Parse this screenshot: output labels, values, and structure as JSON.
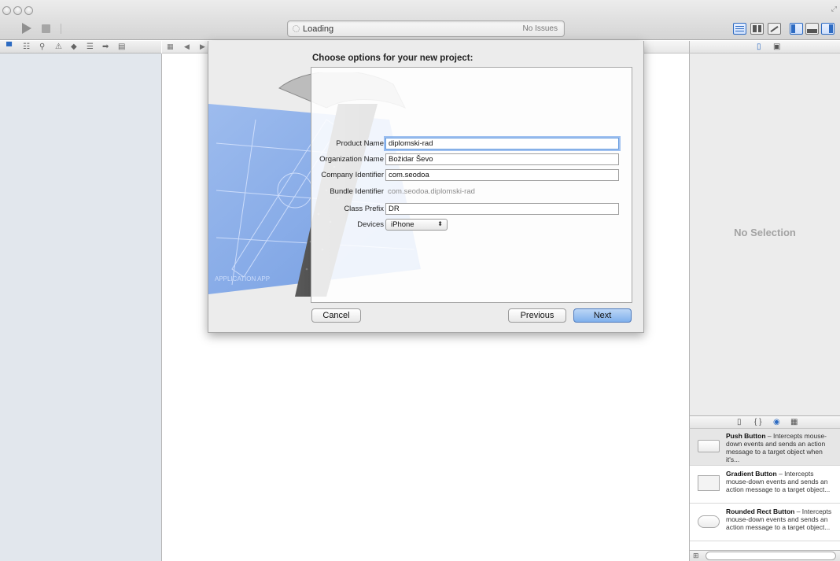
{
  "toolbar": {
    "activity_status": "Loading",
    "issues_status": "No Issues"
  },
  "inspector": {
    "empty_message": "No Selection"
  },
  "dialog": {
    "title": "Choose options for your new project:",
    "fields": {
      "product_name": {
        "label": "Product Name",
        "value": "diplomski-rad"
      },
      "organization_name": {
        "label": "Organization Name",
        "value": "Božidar Ševo"
      },
      "company_identifier": {
        "label": "Company Identifier",
        "value": "com.seodoa"
      },
      "bundle_identifier": {
        "label": "Bundle Identifier",
        "value": "com.seodoa.diplomski-rad"
      },
      "class_prefix": {
        "label": "Class Prefix",
        "value": "DR"
      },
      "devices": {
        "label": "Devices",
        "value": "iPhone"
      }
    },
    "buttons": {
      "cancel": "Cancel",
      "previous": "Previous",
      "next": "Next"
    }
  },
  "library": {
    "items": [
      {
        "name": "Push Button",
        "description": " – Intercepts mouse-down events and sends an action message to a target object when it's..."
      },
      {
        "name": "Gradient Button",
        "description": " – Intercepts mouse-down events and sends an action message to a target object..."
      },
      {
        "name": "Rounded Rect Button",
        "description": " – Intercepts mouse-down events and sends an action message to a target object..."
      }
    ]
  },
  "colors": {
    "accent": "#2d6bc2",
    "sidebar_bg": "#e2e7ed",
    "default_button": "#7fb0ec"
  }
}
